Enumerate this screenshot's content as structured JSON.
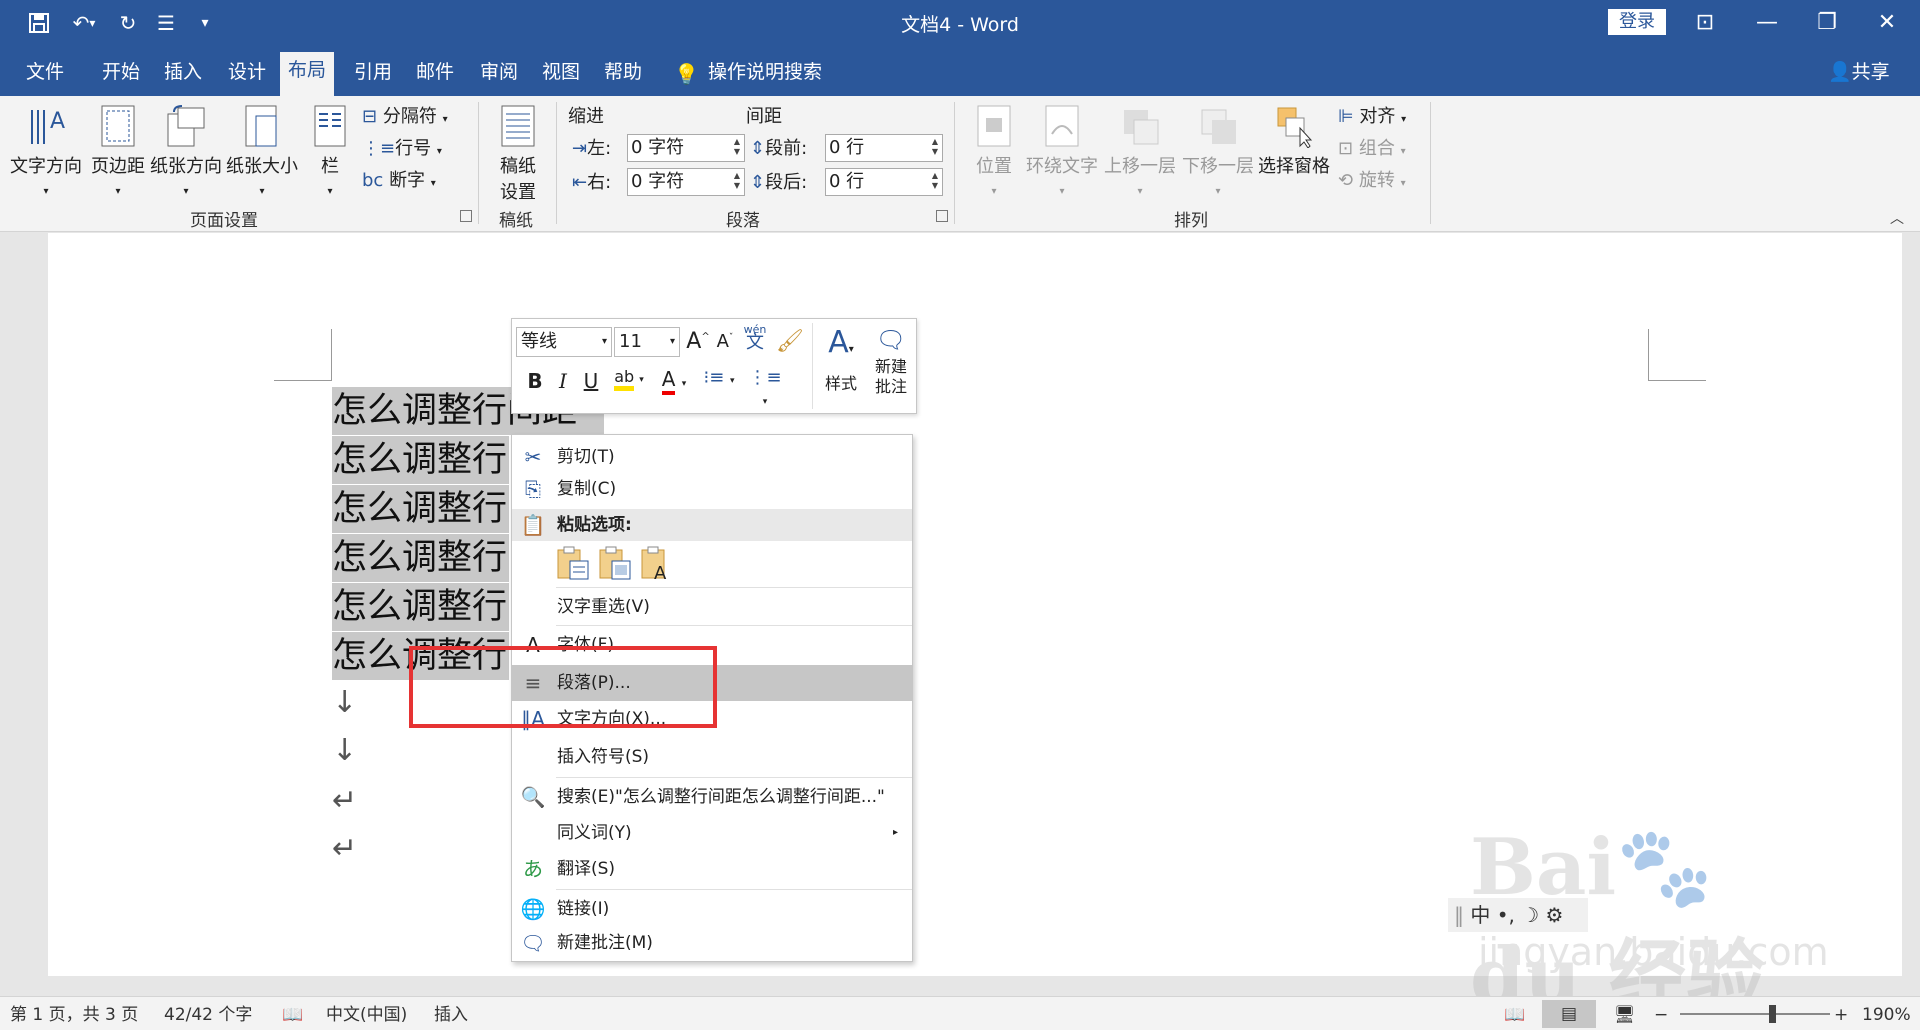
{
  "titlebar": {
    "title": "文档4 - Word",
    "login": "登录",
    "icons": [
      "save-icon",
      "undo-icon",
      "redo-icon",
      "touch-mode-icon",
      "customize-icon"
    ]
  },
  "tabs": [
    "文件",
    "开始",
    "插入",
    "设计",
    "布局",
    "引用",
    "邮件",
    "审阅",
    "视图",
    "帮助"
  ],
  "active_tab": "布局",
  "tell_me": "操作说明搜索",
  "share": "共享",
  "ribbon": {
    "page_setup": {
      "label": "页面设置",
      "text_direction": "文字方向",
      "margins": "页边距",
      "orientation": "纸张方向",
      "size": "纸张大小",
      "columns": "栏",
      "breaks": "分隔符",
      "line_numbers": "行号",
      "hyphenation": "断字"
    },
    "manuscript": {
      "label": "稿纸",
      "setup_line1": "稿纸",
      "setup_line2": "设置"
    },
    "paragraph": {
      "label": "段落",
      "indent_title": "缩进",
      "spacing_title": "间距",
      "left_label": "左:",
      "left_value": "0 字符",
      "right_label": "右:",
      "right_value": "0 字符",
      "before_label": "段前:",
      "before_value": "0 行",
      "after_label": "段后:",
      "after_value": "0 行"
    },
    "arrange": {
      "label": "排列",
      "position": "位置",
      "wrap_text": "环绕文字",
      "bring_forward": "上移一层",
      "send_backward": "下移一层",
      "selection_pane": "选择窗格",
      "align": "对齐",
      "group": "组合",
      "rotate": "旋转"
    }
  },
  "document": {
    "lines": [
      "怎么调整行间距",
      "怎么调整行",
      "怎么调整行",
      "怎么调整行",
      "怎么调整行",
      "怎么调整行"
    ]
  },
  "mini_toolbar": {
    "font": "等线",
    "size": "11",
    "phonetic": "wén",
    "phonetic_char": "文",
    "styles": "样式",
    "new_comment_line1": "新建",
    "new_comment_line2": "批注"
  },
  "context_menu": {
    "cut": "剪切(T)",
    "copy": "复制(C)",
    "paste_options": "粘贴选项:",
    "reconvert": "汉字重选(V)",
    "font": "字体(F)...",
    "paragraph": "段落(P)...",
    "text_direction": "文字方向(X)...",
    "insert_symbol": "插入符号(S)",
    "search": "搜索(E)\"怎么调整行间距怎么调整行间距...\"",
    "synonyms": "同义词(Y)",
    "translate": "翻译(S)",
    "link": "链接(I)",
    "new_comment": "新建批注(M)",
    "highlighted_item": "段落(P)..."
  },
  "ime": {
    "mode": "中"
  },
  "watermark": {
    "logo": "Bai du 经验",
    "url": "jingyan.baidu.com"
  },
  "statusbar": {
    "page": "第 1 页，共 3 页",
    "words": "42/42 个字",
    "language": "中文(中国)",
    "mode": "插入",
    "zoom": "190%"
  },
  "colors": {
    "brand": "#2b579a",
    "highlight": "#c6c6c6",
    "annotation_red": "#e63333"
  }
}
